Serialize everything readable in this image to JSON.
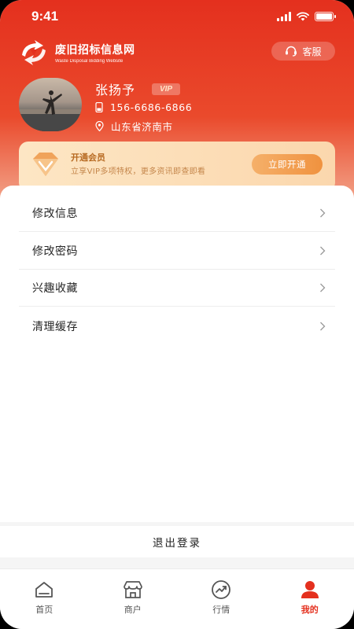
{
  "status_bar": {
    "time": "9:41"
  },
  "brand": {
    "name": "废旧招标信息网",
    "subtitle": "Waste Disposal Bidding Website"
  },
  "header": {
    "service_label": "客服"
  },
  "user": {
    "name": "张扬予",
    "vip_tag": "VIP",
    "phone": "156-6686-6866",
    "location": "山东省济南市"
  },
  "vip_card": {
    "title": "开通会员",
    "subtitle": "立享VIP多项特权，更多资讯即查即看",
    "button": "立即开通"
  },
  "menu": [
    {
      "label": "修改信息"
    },
    {
      "label": "修改密码"
    },
    {
      "label": "兴趣收藏"
    },
    {
      "label": "清理缓存"
    }
  ],
  "logout": {
    "label": "退出登录"
  },
  "tabs": [
    {
      "label": "首页",
      "icon": "home-icon",
      "active": false
    },
    {
      "label": "商户",
      "icon": "store-icon",
      "active": false
    },
    {
      "label": "行情",
      "icon": "trend-icon",
      "active": false
    },
    {
      "label": "我的",
      "icon": "user-icon",
      "active": true
    }
  ],
  "colors": {
    "brand_red": "#e4301e",
    "vip_gold": "#f0923f",
    "tab_inactive": "#555555"
  }
}
